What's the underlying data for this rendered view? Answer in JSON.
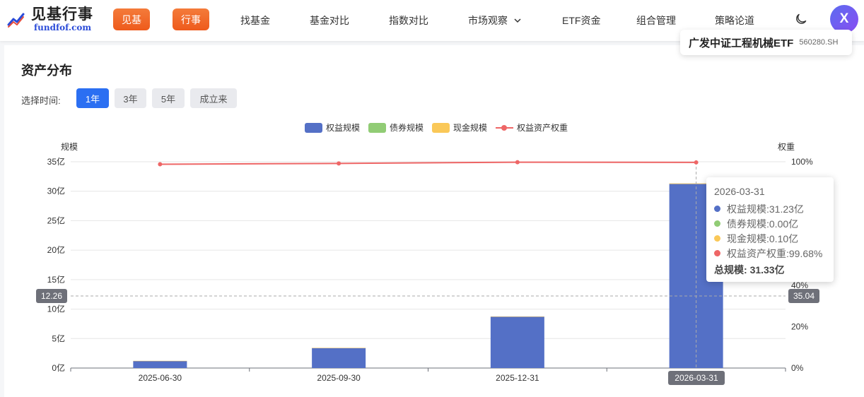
{
  "header": {
    "logo_title": "见基行事",
    "logo_sub": "fundfof.com",
    "pills": [
      "见基",
      "行事"
    ],
    "nav": [
      "找基金",
      "基金对比",
      "指数对比",
      "市场观察",
      "ETF资金",
      "组合管理",
      "策略论道"
    ],
    "avatar": "X"
  },
  "fund": {
    "name": "广发中证工程机械ETF",
    "code": "560280.SH"
  },
  "section": {
    "title": "资产分布",
    "time_label": "选择时间:",
    "time_options": [
      "1年",
      "3年",
      "5年",
      "成立来"
    ],
    "active_option": "1年"
  },
  "chart_data": {
    "type": "bar",
    "categories": [
      "2025-06-30",
      "2025-09-30",
      "2025-12-31",
      "2026-03-31"
    ],
    "series": [
      {
        "name": "权益规模",
        "type": "bar",
        "color": "#5470c6",
        "values": [
          1.2,
          3.4,
          8.7,
          31.23
        ]
      },
      {
        "name": "债券规模",
        "type": "bar",
        "color": "#91cc75",
        "values": [
          0,
          0,
          0,
          0
        ]
      },
      {
        "name": "现金规模",
        "type": "bar",
        "color": "#fac858",
        "values": [
          0.02,
          0.03,
          0.05,
          0.1
        ]
      },
      {
        "name": "权益资产权重",
        "type": "line",
        "color": "#ee6666",
        "axis": "right",
        "values": [
          98.8,
          99.2,
          99.8,
          99.68
        ]
      }
    ],
    "y_left": {
      "label": "规模",
      "ticks": [
        "0亿",
        "5亿",
        "10亿",
        "15亿",
        "20亿",
        "25亿",
        "30亿",
        "35亿"
      ],
      "min": 0,
      "max": 35
    },
    "y_right": {
      "label": "权重",
      "ticks": [
        "0%",
        "20%",
        "40%",
        "100%"
      ],
      "min": 0,
      "max": 100
    },
    "grid": true,
    "legend": "top-center"
  },
  "tooltip": {
    "date": "2026-03-31",
    "rows": [
      {
        "label": "权益规模: ",
        "value": "31.23亿",
        "color": "#5470c6"
      },
      {
        "label": "债券规模: ",
        "value": "0.00亿",
        "color": "#91cc75"
      },
      {
        "label": "现金规模: ",
        "value": "0.10亿",
        "color": "#fac858"
      },
      {
        "label": "权益资产权重: ",
        "value": "99.68%",
        "color": "#ee6666"
      }
    ],
    "total_label": "总规模: ",
    "total_value": "31.33亿"
  },
  "pointer": {
    "left_value": "12.26",
    "right_value": "35.04",
    "x_value": "2026-03-31"
  }
}
